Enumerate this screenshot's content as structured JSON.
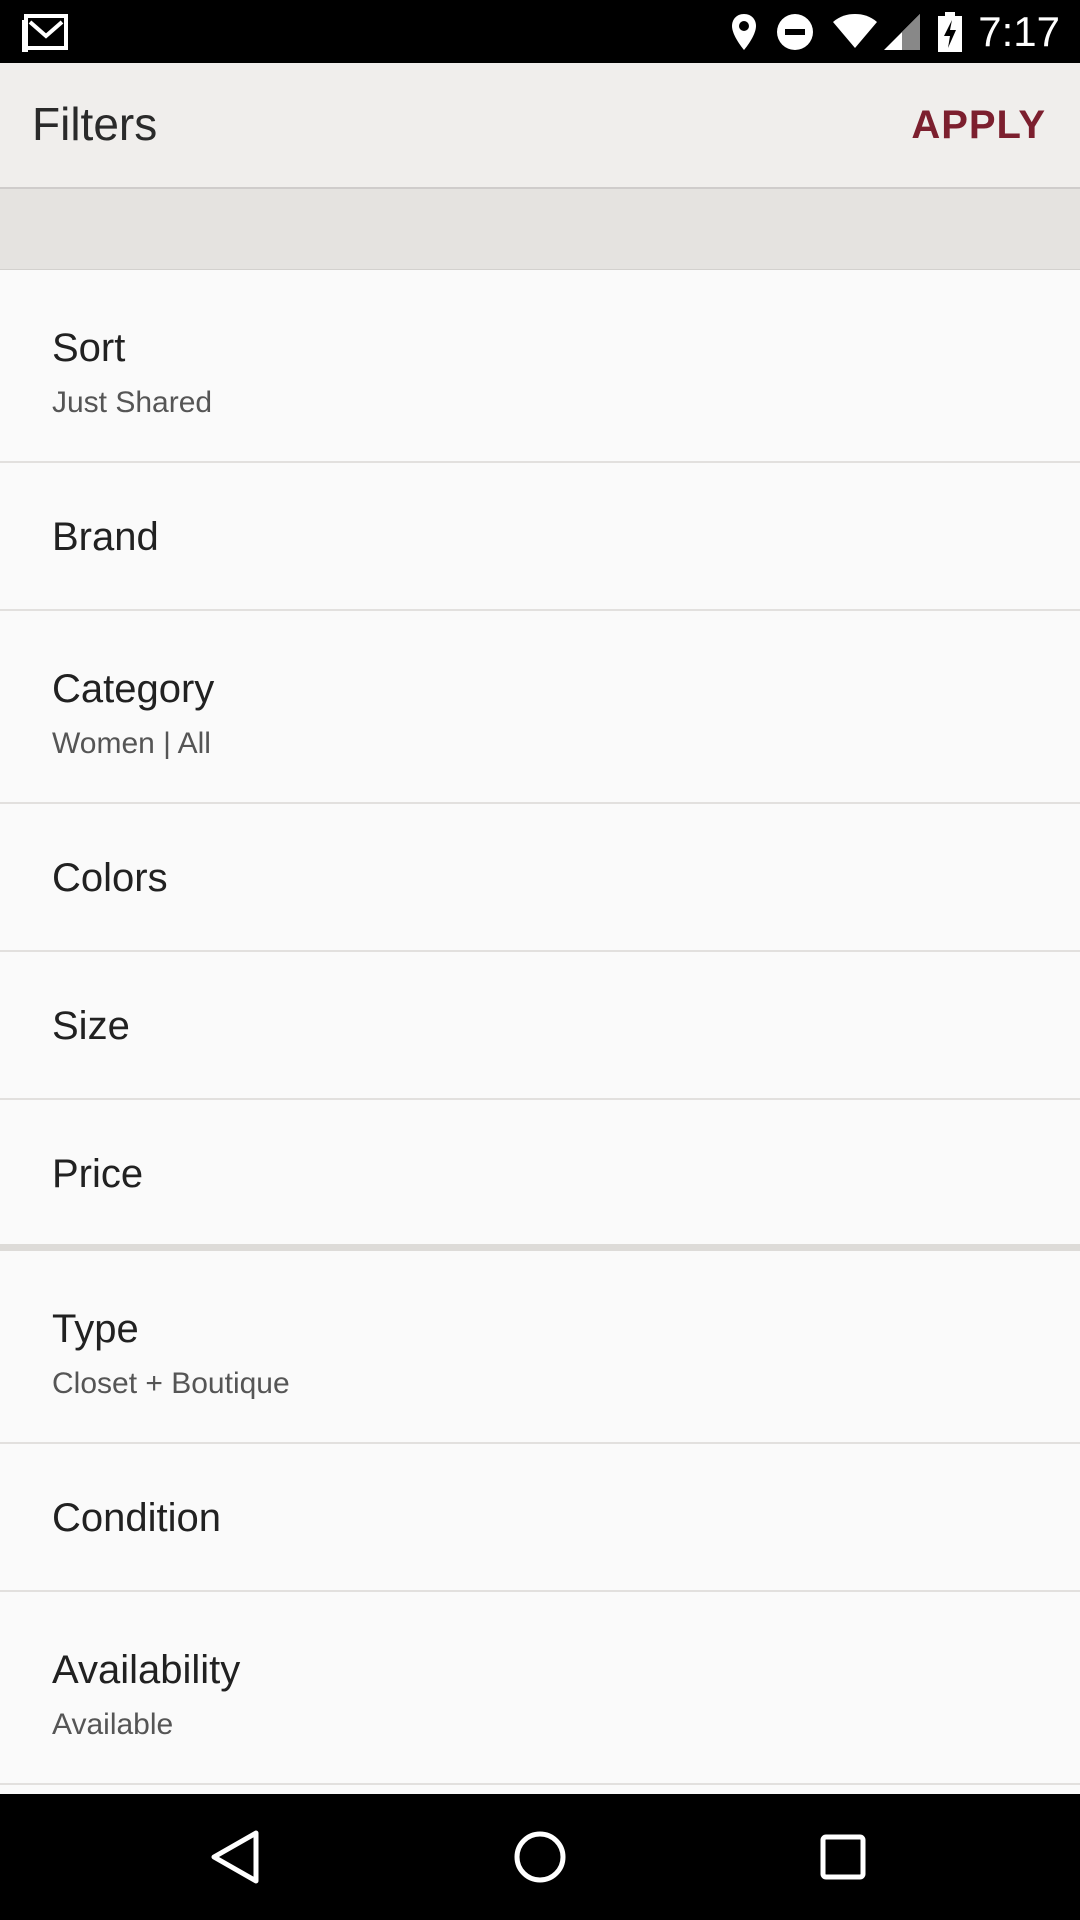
{
  "status_bar": {
    "time": "7:17",
    "icons": [
      "gmail-icon",
      "location-icon",
      "do-not-disturb-icon",
      "wifi-icon",
      "signal-icon",
      "battery-charging-icon"
    ]
  },
  "app_bar": {
    "title": "Filters",
    "apply_label": "APPLY",
    "accent_color": "#7c1f2e"
  },
  "filters": {
    "sort": {
      "label": "Sort",
      "value": "Just Shared"
    },
    "brand": {
      "label": "Brand"
    },
    "category": {
      "label": "Category",
      "value": "Women | All"
    },
    "colors": {
      "label": "Colors"
    },
    "size": {
      "label": "Size"
    },
    "price": {
      "label": "Price"
    },
    "type": {
      "label": "Type",
      "value": "Closet + Boutique"
    },
    "condition": {
      "label": "Condition"
    },
    "availability": {
      "label": "Availability",
      "value": "Available"
    }
  },
  "nav_bar": {
    "icons": [
      "back-icon",
      "home-icon",
      "recents-icon"
    ]
  }
}
